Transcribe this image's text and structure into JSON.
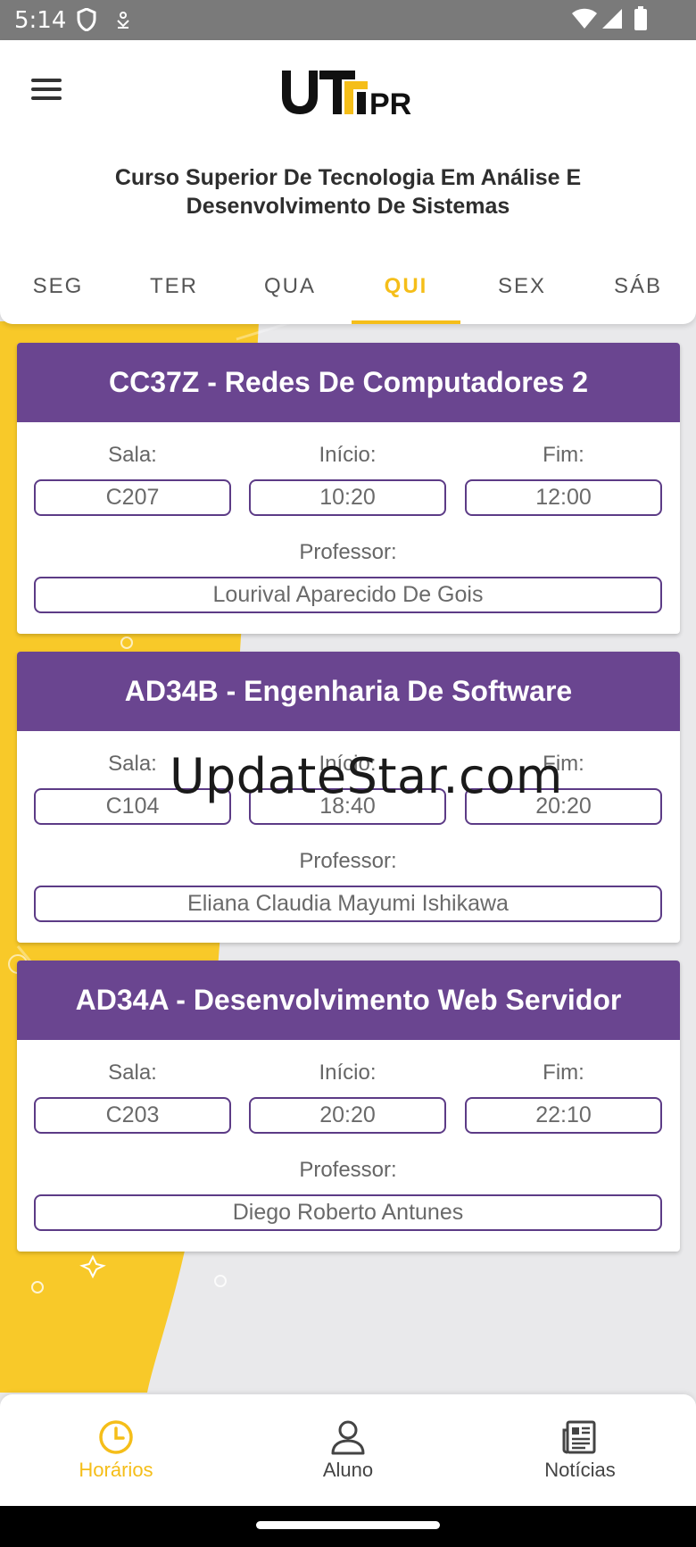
{
  "status_bar": {
    "time": "5:14"
  },
  "header": {
    "course_title": "Curso Superior De Tecnologia Em Análise E Desenvolvimento De Sistemas",
    "logo_text": "UTFPR"
  },
  "tabs": [
    {
      "label": "SEG"
    },
    {
      "label": "TER"
    },
    {
      "label": "QUA"
    },
    {
      "label": "QUI"
    },
    {
      "label": "SEX"
    },
    {
      "label": "SÁB"
    }
  ],
  "selected_tab": "QUI",
  "labels": {
    "room": "Sala:",
    "start": "Início:",
    "end": "Fim:",
    "professor": "Professor:"
  },
  "classes": [
    {
      "title": "CC37Z - Redes De Computadores 2",
      "room": "C207",
      "start": "10:20",
      "end": "12:00",
      "professor": "Lourival Aparecido De Gois"
    },
    {
      "title": "AD34B - Engenharia De Software",
      "room": "C104",
      "start": "18:40",
      "end": "20:20",
      "professor": "Eliana Claudia Mayumi Ishikawa"
    },
    {
      "title": "AD34A - Desenvolvimento Web Servidor",
      "room": "C203",
      "start": "20:20",
      "end": "22:10",
      "professor": "Diego Roberto Antunes"
    }
  ],
  "watermark": "UpdateStar.com",
  "bottom_nav": [
    {
      "label": "Horários",
      "icon": "clock-icon"
    },
    {
      "label": "Aluno",
      "icon": "person-icon"
    },
    {
      "label": "Notícias",
      "icon": "newspaper-icon"
    }
  ],
  "colors": {
    "accent": "#f5be19",
    "card_header": "#6a4590",
    "background_yellow": "#f8c929"
  }
}
